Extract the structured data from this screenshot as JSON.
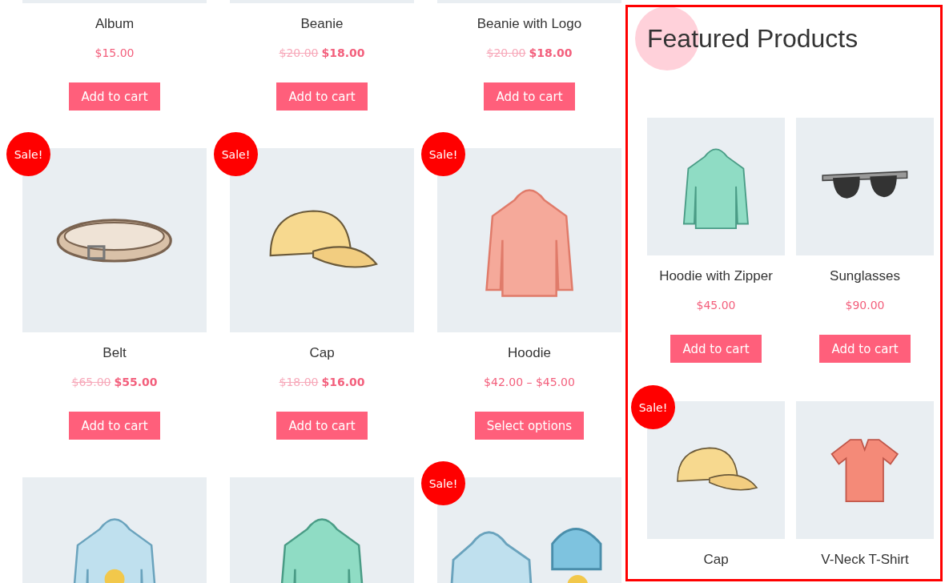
{
  "catalog": {
    "products": [
      {
        "title": "Album",
        "price": "$15.00",
        "button": "Add to cart"
      },
      {
        "title": "Beanie",
        "old_price": "$20.00",
        "price": "$18.00",
        "button": "Add to cart"
      },
      {
        "title": "Beanie with Logo",
        "old_price": "$20.00",
        "price": "$18.00",
        "button": "Add to cart"
      },
      {
        "kind": "belt",
        "badge": "Sale!",
        "title": "Belt",
        "old_price": "$65.00",
        "price": "$55.00",
        "button": "Add to cart"
      },
      {
        "kind": "cap",
        "badge": "Sale!",
        "title": "Cap",
        "old_price": "$18.00",
        "price": "$16.00",
        "button": "Add to cart"
      },
      {
        "kind": "hoodie",
        "badge": "Sale!",
        "title": "Hoodie",
        "price": "$42.00 – $45.00",
        "button": "Select options"
      },
      {
        "kind": "hoodie-logo"
      },
      {
        "kind": "hoodie-zipper"
      },
      {
        "kind": "hoodie-beanie",
        "badge": "Sale!"
      }
    ]
  },
  "featured": {
    "title": "Featured Products",
    "products": [
      {
        "kind": "hoodie-zipper",
        "title": "Hoodie with Zipper",
        "price": "$45.00",
        "button": "Add to cart"
      },
      {
        "kind": "sunglasses",
        "title": "Sunglasses",
        "price": "$90.00",
        "button": "Add to cart"
      },
      {
        "kind": "cap",
        "badge": "Sale!",
        "title": "Cap"
      },
      {
        "kind": "tshirt",
        "title": "V-Neck T-Shirt"
      }
    ]
  }
}
